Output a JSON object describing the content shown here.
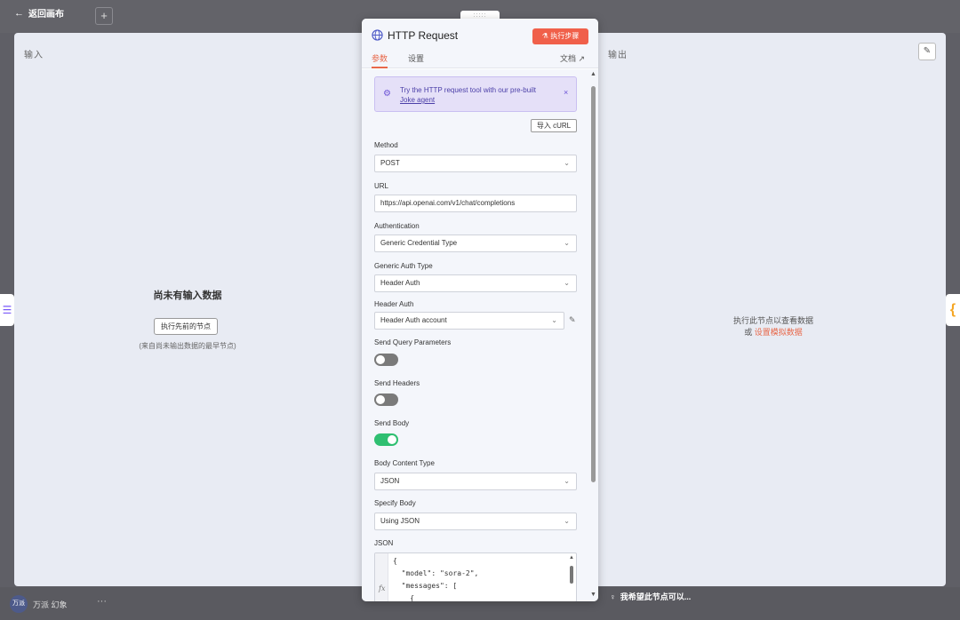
{
  "topbar": {
    "back_label": "返回画布",
    "plus_label": "+"
  },
  "modal": {
    "input_label": "输入",
    "output_label": "输出",
    "empty_title": "尚未有输入数据",
    "run_previous_label": "执行先前的节点",
    "empty_sub": "(来自尚未输出数据的最早节点)",
    "output_msg_line1": "执行此节点以查看数据",
    "output_msg_or": "或",
    "output_msg_link": "设置模拟数据"
  },
  "panel": {
    "title": "HTTP Request",
    "execute_label": "执行步骤",
    "tabs": {
      "params": "参数",
      "settings": "设置",
      "docs": "文档"
    },
    "banner": {
      "text": "Try the HTTP request tool with our pre-built",
      "link": "Joke agent",
      "close": "×"
    },
    "import_curl": "导入 cURL",
    "fields": {
      "method": {
        "label": "Method",
        "value": "POST"
      },
      "url": {
        "label": "URL",
        "value": "https://api.openai.com/v1/chat/completions"
      },
      "authentication": {
        "label": "Authentication",
        "value": "Generic Credential Type"
      },
      "generic_auth_type": {
        "label": "Generic Auth Type",
        "value": "Header Auth"
      },
      "header_auth": {
        "label": "Header Auth",
        "value": "Header Auth account"
      },
      "send_query": {
        "label": "Send Query Parameters",
        "on": false
      },
      "send_headers": {
        "label": "Send Headers",
        "on": false
      },
      "send_body": {
        "label": "Send Body",
        "on": true
      },
      "body_content_type": {
        "label": "Body Content Type",
        "value": "JSON"
      },
      "specify_body": {
        "label": "Specify Body",
        "value": "Using JSON"
      },
      "json": {
        "label": "JSON",
        "lines": [
          "{",
          "  \"model\": \"sora-2\",",
          "  \"messages\": [",
          "    {"
        ]
      }
    }
  },
  "bottombar": {
    "avatar": "万派",
    "user_name": "万派 幻象",
    "more": "···",
    "hint": "我希望此节点可以..."
  },
  "colors": {
    "accent": "#f0604a",
    "toggle_on": "#2fbf71",
    "banner_bg": "#e5e0f8"
  },
  "icons": [
    "globe-icon",
    "robot-icon",
    "close-icon",
    "chevron-down-icon",
    "pencil-icon",
    "external-link-icon",
    "fx-icon",
    "lightbulb-icon",
    "back-arrow-icon"
  ]
}
